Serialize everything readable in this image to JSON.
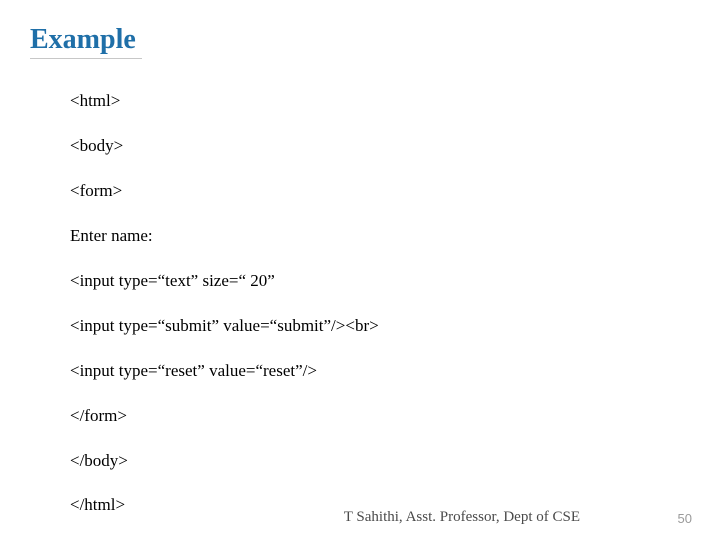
{
  "title": "Example",
  "code_lines": [
    "<html>",
    "<body>",
    "<form>",
    "Enter name:",
    "<input type=“text” size=“ 20”",
    "<input type=“submit” value=“submit”/><br>",
    "<input type=“reset” value=“reset”/>",
    "</form>",
    "</body>",
    "</html>"
  ],
  "footer": "T Sahithi, Asst. Professor, Dept of CSE",
  "page_number": "50"
}
